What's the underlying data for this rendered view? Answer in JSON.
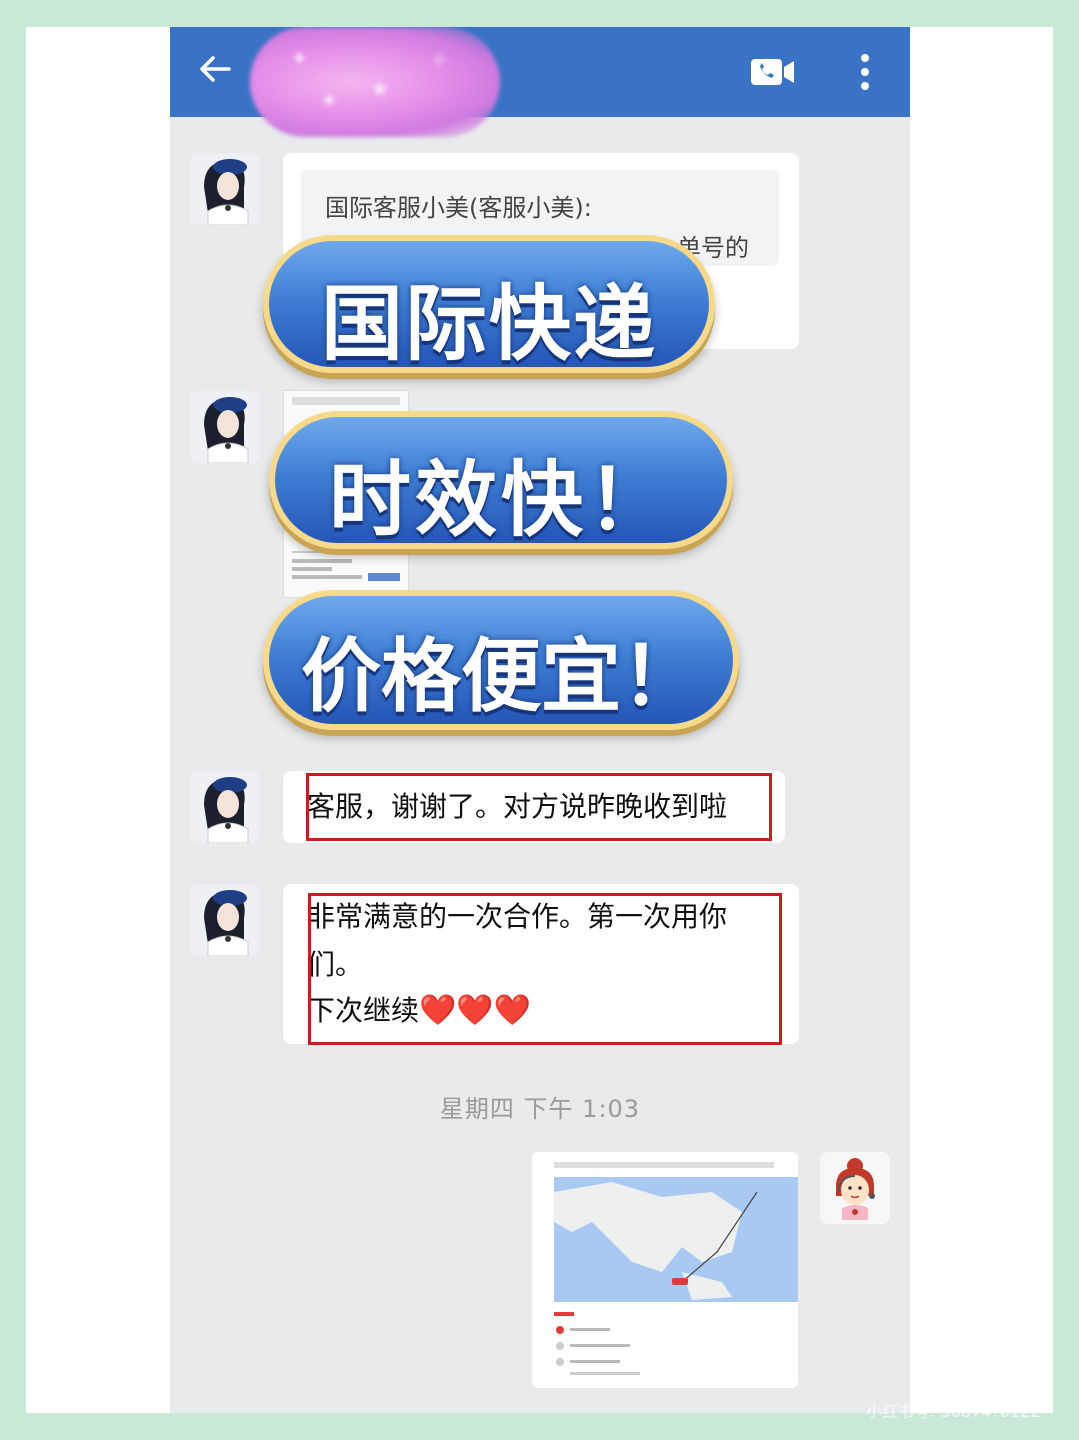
{
  "header": {
    "back_icon": "arrow-left-icon",
    "video_call_icon": "video-call-icon",
    "more_icon": "more-vertical-icon",
    "accent": "#3a73c5"
  },
  "messages": {
    "quoted_sender": "国际客服小美(客服小美):",
    "quoted_fragment": "单号的",
    "thanks": "客服，谢谢了。对方说昨晚收到啦",
    "satisfied_line1": "非常满意的一次合作。第一次用你",
    "satisfied_line2": "们。",
    "satisfied_line3": "下次继续",
    "hearts": "❤️❤️❤️"
  },
  "overlay": {
    "headline1": "国际快递",
    "headline2": "时效快！",
    "headline3": "价格便宜！"
  },
  "timestamp": "星期四   下午 1:03",
  "watermark": {
    "badge": "小红书",
    "text": "小红书号: 56874?0122"
  },
  "colors": {
    "highlight_box": "#c61f23",
    "pill_blue": "#3f7fd6",
    "pill_border": "#f6d98a"
  }
}
